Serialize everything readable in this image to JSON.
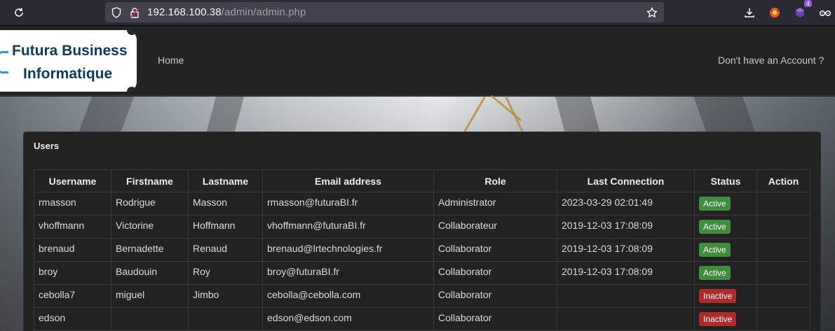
{
  "browser": {
    "url_host": "192.168.100.38",
    "url_path": "/admin/admin.php",
    "extension_badge": "4"
  },
  "site": {
    "logo_line1": "Futura Business",
    "logo_line2": "Informatique",
    "nav_home": "Home",
    "nav_account": "Don't have an Account ?"
  },
  "panel": {
    "title": "Users"
  },
  "table": {
    "headers": [
      "Username",
      "Firstname",
      "Lastname",
      "Email address",
      "Role",
      "Last Connection",
      "Status",
      "Action"
    ],
    "rows": [
      {
        "username": "rmasson",
        "firstname": "Rodrigue",
        "lastname": "Masson",
        "email": "rmasson@futuraBI.fr",
        "role": "Administrator",
        "last": "2023-03-29 02:01:49",
        "status": "Active",
        "action": ""
      },
      {
        "username": "vhoffmann",
        "firstname": "Victorine",
        "lastname": "Hoffmann",
        "email": "vhoffmann@futuraBI.fr",
        "role": "Collaborateur",
        "last": "2019-12-03 17:08:09",
        "status": "Active",
        "action": ""
      },
      {
        "username": "brenaud",
        "firstname": "Bernadette",
        "lastname": "Renaud",
        "email": "brenaud@lrtechnologies.fr",
        "role": "Collaborator",
        "last": "2019-12-03 17:08:09",
        "status": "Active",
        "action": ""
      },
      {
        "username": "broy",
        "firstname": "Baudouin",
        "lastname": "Roy",
        "email": "broy@futuraBI.fr",
        "role": "Collaborator",
        "last": "2019-12-03 17:08:09",
        "status": "Active",
        "action": ""
      },
      {
        "username": "cebolla7",
        "firstname": "miguel",
        "lastname": "Jimbo",
        "email": "cebolla@cebolla.com",
        "role": "Collaborator",
        "last": "",
        "status": "Inactive",
        "action": ""
      },
      {
        "username": "edson",
        "firstname": "",
        "lastname": "",
        "email": "edson@edson.com",
        "role": "Collaborator",
        "last": "",
        "status": "Inactive",
        "action": ""
      }
    ]
  },
  "colors": {
    "active": "#3e8e3e",
    "inactive": "#b02a2a",
    "brand": "#0e3b5b"
  }
}
